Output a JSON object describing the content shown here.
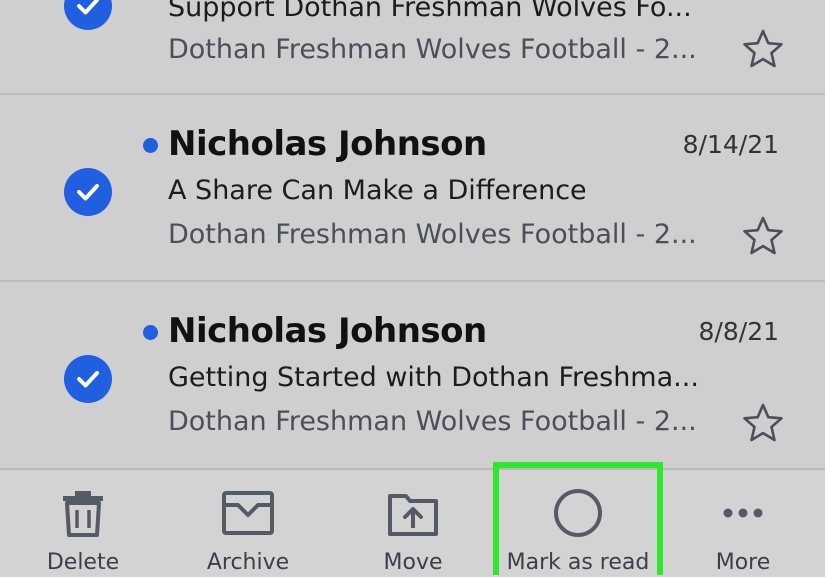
{
  "emails": [
    {
      "sender": "",
      "date": "",
      "subject": "Support Dothan Freshman Wolves Fo...",
      "preview": "Dothan Freshman Wolves Football - 2...",
      "selected": true,
      "unread": false
    },
    {
      "sender": "Nicholas Johnson",
      "date": "8/14/21",
      "subject": "A Share Can Make a Difference",
      "preview": "Dothan Freshman Wolves Football - 2...",
      "selected": true,
      "unread": true
    },
    {
      "sender": "Nicholas Johnson",
      "date": "8/8/21",
      "subject": "Getting Started with Dothan Freshma...",
      "preview": "Dothan Freshman Wolves Football - 2...",
      "selected": true,
      "unread": true
    }
  ],
  "toolbar": {
    "delete_label": "Delete",
    "archive_label": "Archive",
    "move_label": "Move",
    "mark_read_label": "Mark as read",
    "more_label": "More"
  },
  "colors": {
    "accent": "#1f5fe0",
    "highlight": "#2ee82e",
    "background": "#cfcfcf"
  },
  "icons": [
    "check-icon",
    "star-icon",
    "unread-dot-icon",
    "trash-icon",
    "archive-icon",
    "move-icon",
    "circle-icon",
    "ellipsis-icon"
  ]
}
